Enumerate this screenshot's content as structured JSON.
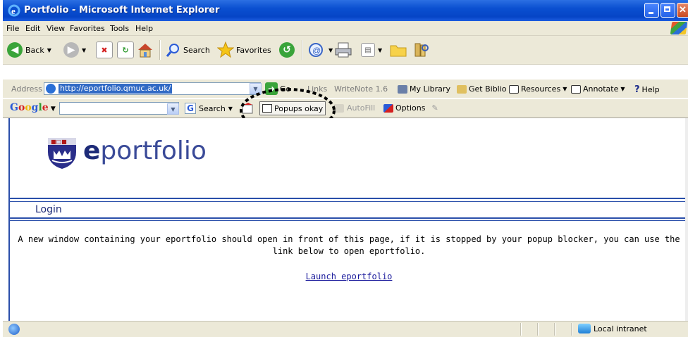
{
  "window": {
    "title": "Portfolio - Microsoft Internet Explorer"
  },
  "menu": {
    "items": [
      "File",
      "Edit",
      "View",
      "Favorites",
      "Tools",
      "Help"
    ]
  },
  "toolbar": {
    "back_label": "Back",
    "search_label": "Search",
    "favorites_label": "Favorites"
  },
  "address": {
    "label": "Address",
    "url": "http://eportfolio.qmuc.ac.uk/",
    "go_label": "Go",
    "links_label": "Links",
    "links": [
      "WriteNote 1.6",
      "My Library",
      "Get Biblio",
      "Resources",
      "Annotate",
      "Help"
    ]
  },
  "google": {
    "logo": "Google",
    "search_label": "Search",
    "popups_label": "Popups okay",
    "autofill_label": "AutoFill",
    "options_label": "Options"
  },
  "page": {
    "logo_e": "e",
    "logo_rest": "portfolio",
    "section_title": "Login",
    "message": "A new window containing your eportfolio should open in front of this page, if it is stopped by your popup blocker, you can use the link below to open eportfolio.",
    "link_text": "Launch eportfolio"
  },
  "status": {
    "zone_label": "Local intranet"
  },
  "colors": {
    "titlebar": "#0a4fd0",
    "chrome": "#ece9d8",
    "page_accent": "#2a4faa",
    "logo_text": "#1d2b78",
    "link": "#1a1a9c"
  }
}
